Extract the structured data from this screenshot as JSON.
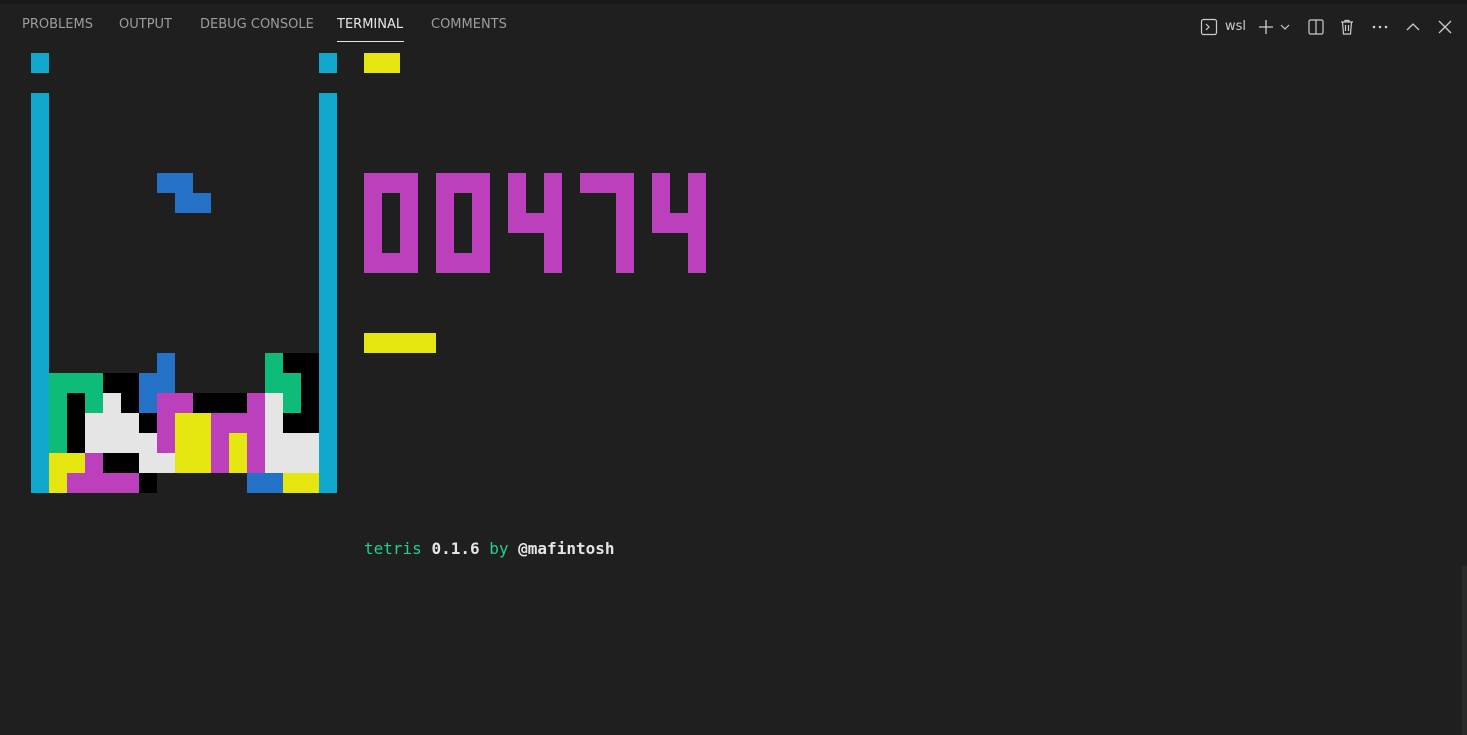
{
  "tabs": [
    "PROBLEMS",
    "OUTPUT",
    "DEBUG CONSOLE",
    "TERMINAL",
    "COMMENTS"
  ],
  "active_tab": "TERMINAL",
  "toolbar": {
    "profile": "wsl",
    "icons": [
      "terminal-profile-icon",
      "new-terminal-icon",
      "chevron-down-icon",
      "split-terminal-icon",
      "trash-icon",
      "more-actions-icon",
      "maximize-panel-icon",
      "close-icon"
    ]
  },
  "game": {
    "score": "00474",
    "colors": {
      "wall": "#11a8cd",
      "green": "#0dbc79",
      "blue": "#2472c8",
      "magenta": "#bc3fbc",
      "yellow": "#e5e510",
      "white": "#e5e5e5",
      "black": "#000000",
      "score": "#bc3fbc"
    },
    "falling_piece": "Z",
    "rows": [
      "..........",
      "..........",
      "..........",
      "..........",
      "..........",
      "..........",
      "..........",
      "..........",
      "..........",
      "..........",
      "..........",
      "......B...",
      "..............",
      "..............",
      "..............",
      ".............."
    ]
  },
  "credit": {
    "prefix": "tetris",
    "version": "0.1.6",
    "by": "by",
    "author": "@mafintosh"
  }
}
